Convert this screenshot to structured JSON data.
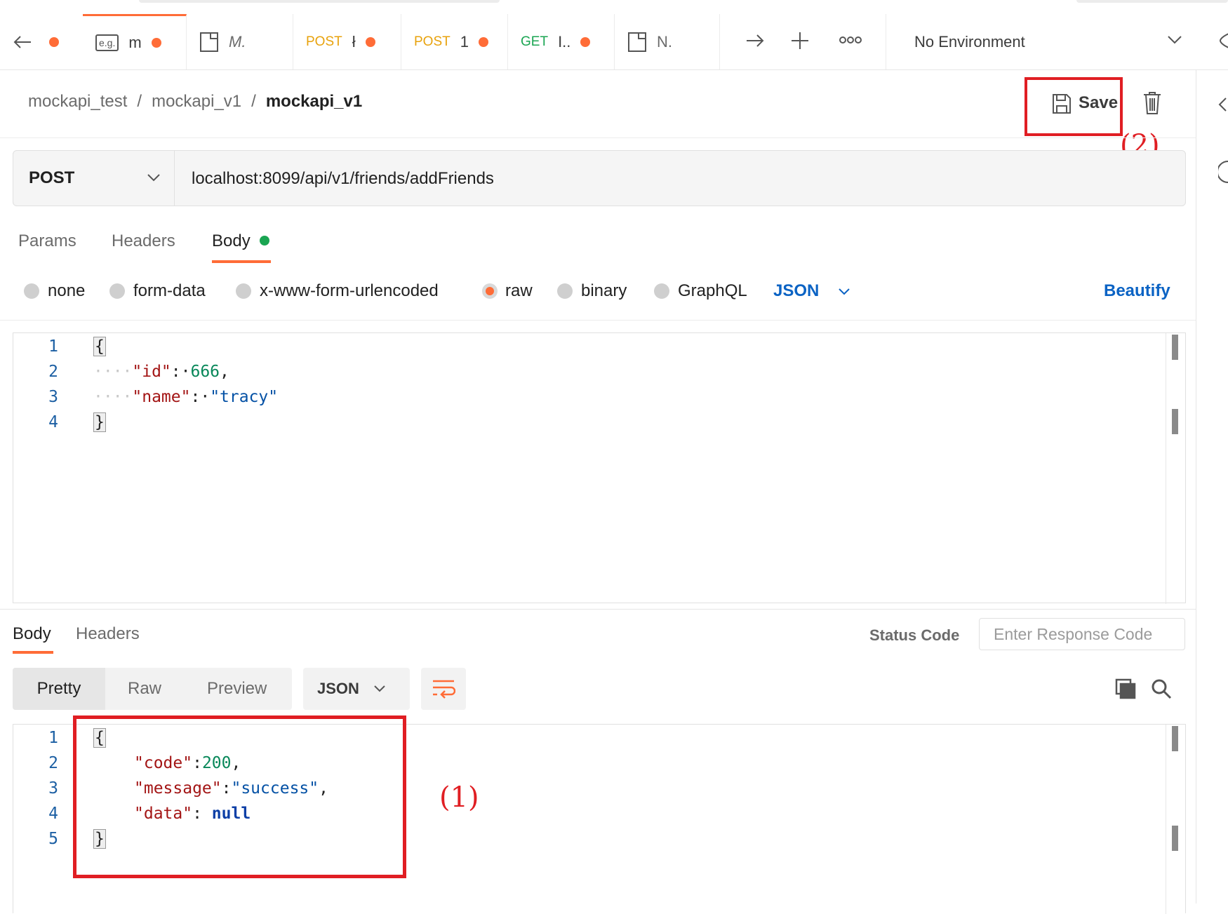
{
  "tabs": [
    {
      "label": ""
    },
    {
      "icon_text": "e.g.",
      "label": "m"
    },
    {
      "label": "M."
    },
    {
      "method": "POST",
      "label": "ł"
    },
    {
      "method": "POST",
      "label": "1"
    },
    {
      "method": "GET",
      "label": "I.."
    },
    {
      "label": "N."
    }
  ],
  "environment": {
    "selected": "No Environment"
  },
  "breadcrumb": {
    "collection": "mockapi_test",
    "folder": "mockapi_v1",
    "request": "mockapi_v1",
    "separator": "/"
  },
  "toolbar": {
    "save_label": "Save"
  },
  "request": {
    "method": "POST",
    "url": "localhost:8099/api/v1/friends/addFriends"
  },
  "request_tabs": {
    "params": "Params",
    "headers": "Headers",
    "body": "Body"
  },
  "body_types": {
    "none": "none",
    "form_data": "form-data",
    "urlencoded": "x-www-form-urlencoded",
    "raw": "raw",
    "binary": "binary",
    "graphql": "GraphQL",
    "format": "JSON",
    "beautify": "Beautify"
  },
  "request_body": {
    "line_numbers": [
      "1",
      "2",
      "3",
      "4"
    ],
    "open": "{",
    "close": "}",
    "k1": "\"id\"",
    "v1": "666",
    "k2": "\"name\"",
    "v2": "\"tracy\""
  },
  "response_tabs": {
    "body": "Body",
    "headers": "Headers"
  },
  "status_code": {
    "label": "Status Code",
    "placeholder": "Enter Response Code"
  },
  "view_modes": {
    "pretty": "Pretty",
    "raw": "Raw",
    "preview": "Preview",
    "format": "JSON"
  },
  "response_body": {
    "line_numbers": [
      "1",
      "2",
      "3",
      "4",
      "5"
    ],
    "open": "{",
    "close": "}",
    "k1": "\"code\"",
    "v1": "200",
    "k2": "\"message\"",
    "v2": "\"success\"",
    "k3": "\"data\"",
    "v3": "null"
  },
  "annotations": {
    "one": "(1)",
    "two": "(2)"
  },
  "colors": {
    "accent": "#ff6c37",
    "annotation": "#e01e23",
    "link": "#0b63c4",
    "success_dot": "#1aa552"
  }
}
